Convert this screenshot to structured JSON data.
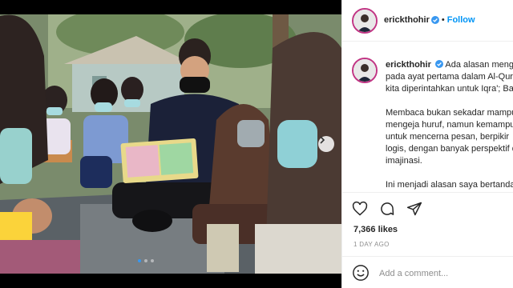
{
  "post": {
    "username": "erickthohir",
    "follow_label": "Follow",
    "separator": "•"
  },
  "caption": {
    "line1": "Ada alasan mengapa",
    "line2": "pada ayat pertama dalam Al-Qur'an",
    "line3": "kita diperintahkan untuk Iqra'; Baca.",
    "para2_line1": "Membaca bukan sekadar mampu",
    "para2_line2": "mengeja huruf, namun kemampuan",
    "para2_line3": "untuk mencerna pesan, berpikir",
    "para2_line4": "logis, dengan banyak perspektif dan",
    "para2_line5": "imajinasi.",
    "para3_line1": "Ini menjadi alasan saya bertandang"
  },
  "stats": {
    "likes": "7,366 likes",
    "age": "1 DAY AGO"
  },
  "comment": {
    "placeholder": "Add a comment..."
  },
  "icons": {
    "verified": "verified-badge-icon",
    "like": "heart-icon",
    "comment": "comment-icon",
    "share": "share-icon",
    "emoji": "emoji-icon",
    "next": "chevron-right-icon"
  },
  "colors": {
    "accent": "#0095f6",
    "story_ring": "#c13584",
    "carousel_active": "#3897f0"
  }
}
